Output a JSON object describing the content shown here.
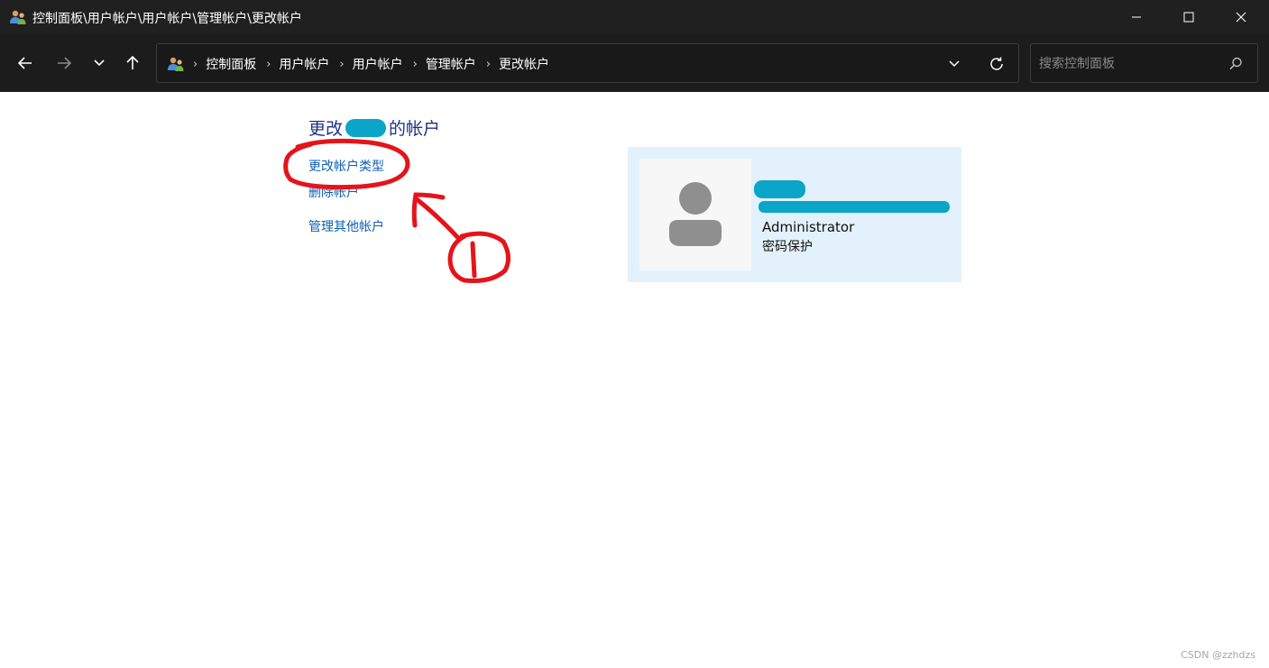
{
  "window": {
    "title": "控制面板\\用户帐户\\用户帐户\\管理帐户\\更改帐户"
  },
  "breadcrumbs": [
    "控制面板",
    "用户帐户",
    "用户帐户",
    "管理帐户",
    "更改帐户"
  ],
  "search": {
    "placeholder": "搜索控制面板"
  },
  "page": {
    "heading_prefix": "更改",
    "heading_suffix": "的帐户"
  },
  "links": {
    "change_type": "更改帐户类型",
    "delete": "删除帐户",
    "manage_other": "管理其他帐户"
  },
  "account": {
    "type": "Administrator",
    "status": "密码保护"
  },
  "annotation": {
    "label": "①",
    "color": "#e4141a"
  },
  "watermark": "CSDN @zzhdzs",
  "colors": {
    "titlebar": "#202020",
    "link": "#0f5fb3",
    "heading": "#1e3287",
    "card": "#e3f1fc",
    "redaction": "#0aa5c8"
  }
}
